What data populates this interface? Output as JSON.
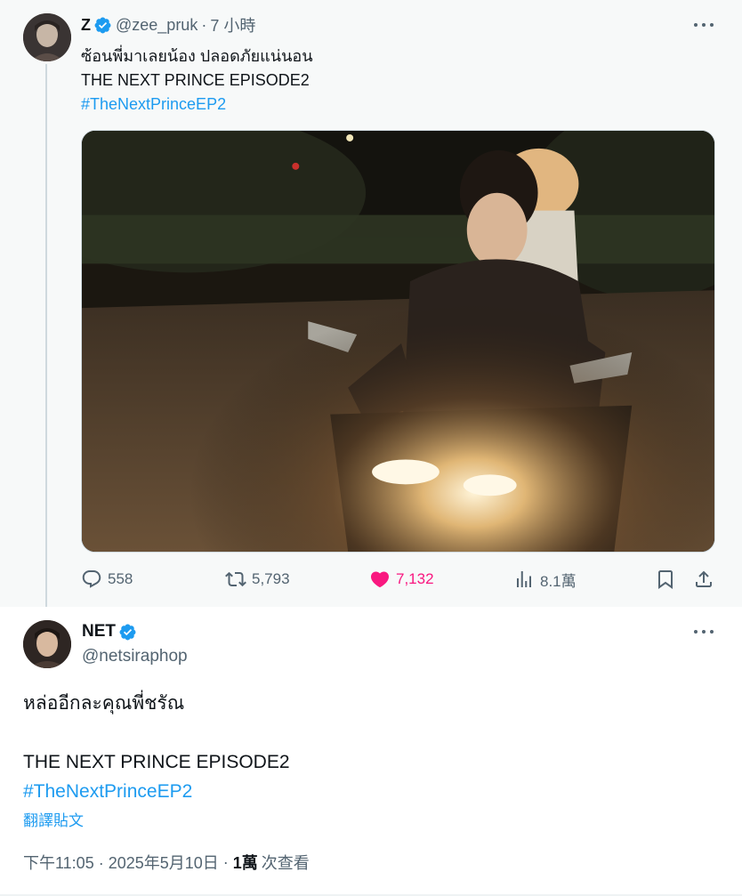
{
  "parent_tweet": {
    "author_name": "Z",
    "handle": "@zee_pruk",
    "separator": "·",
    "time": "7 小時",
    "text_line1": "ซ้อนพี่มาเลยน้อง ปลอดภัยแน่นอน",
    "text_line2": "THE NEXT PRINCE EPISODE2",
    "hashtag": "#TheNextPrinceEP2",
    "stats": {
      "replies": "558",
      "retweets": "5,793",
      "likes": "7,132",
      "views": "8.1萬"
    },
    "liked": true
  },
  "main_tweet": {
    "author_name": "NET",
    "handle": "@netsiraphop",
    "text_line1": "หล่ออีกละคุณพี่ชรัณ",
    "text_line2": "THE NEXT PRINCE EPISODE2",
    "hashtag": "#TheNextPrinceEP2",
    "translate_label": "翻譯貼文",
    "timestamp": "下午11:05 · 2025年5月10日",
    "separator": "·",
    "views_count": "1萬",
    "views_label": "次查看"
  },
  "icons": {
    "verified": "verified-badge-icon",
    "more": "more-options-icon",
    "reply": "reply-icon",
    "retweet": "retweet-icon",
    "like": "heart-icon",
    "views": "views-chart-icon",
    "bookmark": "bookmark-icon",
    "share": "share-icon"
  },
  "colors": {
    "accent": "#1d9bf0",
    "like": "#f91880",
    "secondary_text": "#536471",
    "parent_background": "#f7f9f9"
  }
}
